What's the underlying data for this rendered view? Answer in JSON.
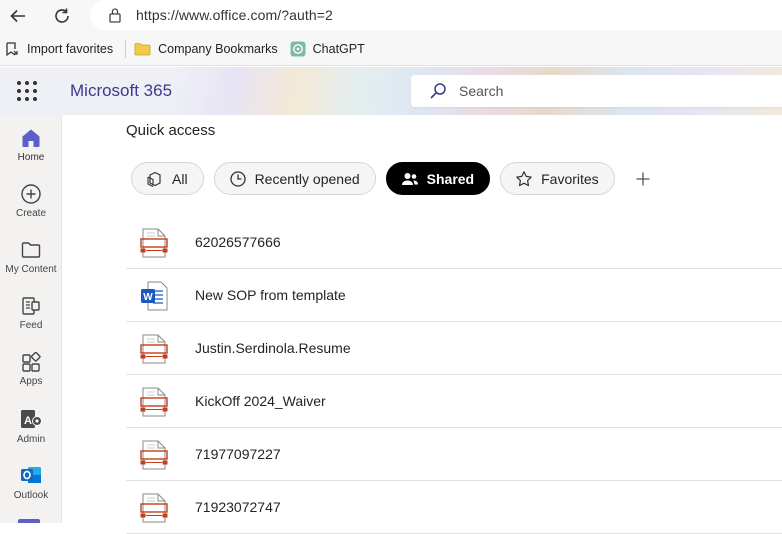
{
  "browser": {
    "url": "https://www.office.com/?auth=2",
    "favorites": [
      {
        "label": "Import favorites",
        "icon": "import-favorites-icon"
      },
      {
        "label": "Company Bookmarks",
        "icon": "folder-icon"
      },
      {
        "label": "ChatGPT",
        "icon": "chatgpt-icon"
      }
    ]
  },
  "header": {
    "app_title": "Microsoft 365",
    "search_placeholder": "Search"
  },
  "rail": {
    "items": [
      {
        "label": "Home",
        "icon": "home-icon"
      },
      {
        "label": "Create",
        "icon": "create-icon"
      },
      {
        "label": "My Content",
        "icon": "folder-icon"
      },
      {
        "label": "Feed",
        "icon": "feed-icon"
      },
      {
        "label": "Apps",
        "icon": "apps-icon"
      },
      {
        "label": "Admin",
        "icon": "admin-icon"
      },
      {
        "label": "Outlook",
        "icon": "outlook-icon"
      }
    ]
  },
  "main": {
    "section_title": "Quick access",
    "filters": [
      {
        "label": "All",
        "icon": "all-files-icon"
      },
      {
        "label": "Recently opened",
        "icon": "clock-icon"
      },
      {
        "label": "Shared",
        "icon": "people-icon",
        "active": true
      },
      {
        "label": "Favorites",
        "icon": "star-icon"
      }
    ],
    "files": [
      {
        "name": "62026577666",
        "type": "pdf"
      },
      {
        "name": "New SOP from template",
        "type": "word"
      },
      {
        "name": "Justin.Serdinola.Resume",
        "type": "pdf"
      },
      {
        "name": "KickOff 2024_Waiver",
        "type": "pdf"
      },
      {
        "name": "71977097227",
        "type": "pdf"
      },
      {
        "name": "71923072747",
        "type": "pdf"
      }
    ]
  },
  "colors": {
    "accent": "#3b3a8c",
    "home_icon": "#5b5fc7",
    "pdf_red": "#c43e1c",
    "word_blue": "#185abd"
  }
}
